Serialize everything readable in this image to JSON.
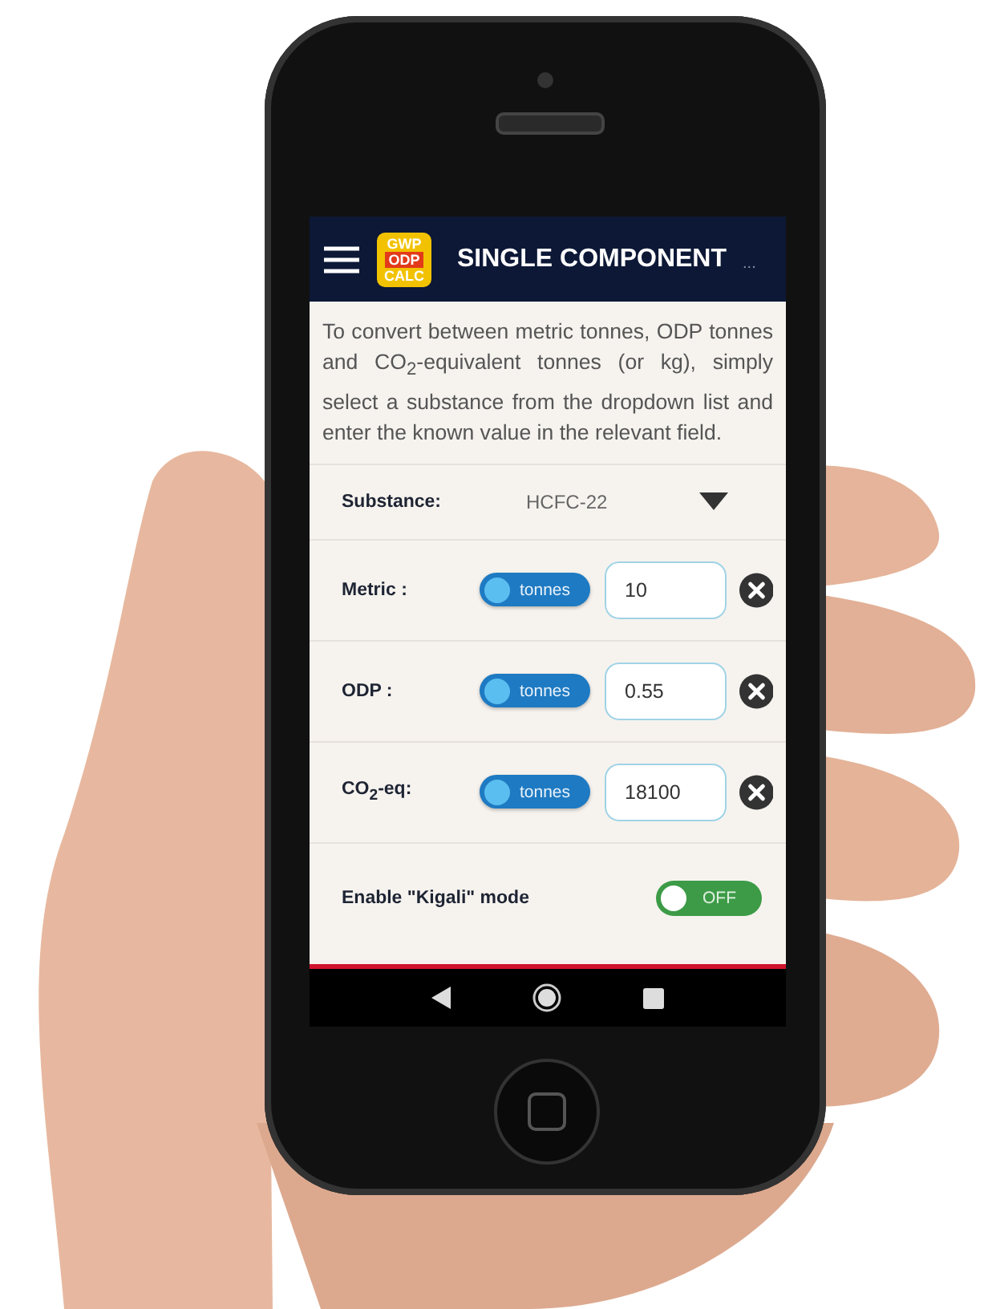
{
  "header": {
    "logo": [
      "GWP",
      "ODP",
      "CALC"
    ],
    "title": "SINGLE COMPONENT",
    "more": "..."
  },
  "intro": "To convert between metric tonnes, ODP tonnes and CO$_{2}$-equivalent tonnes (or kg), simply select a substance from the dropdown list and enter the known value in the relevant field.",
  "substance": {
    "label": "Substance:",
    "value": "HCFC-22"
  },
  "fields": [
    {
      "label": "Metric :",
      "unit": "tonnes",
      "value": "10"
    },
    {
      "label": "ODP :",
      "unit": "tonnes",
      "value": "0.55"
    },
    {
      "label": "CO$_{2}$-eq:",
      "unit": "tonnes",
      "value": "18100"
    }
  ],
  "kigali": {
    "label": "Enable \"Kigali\" mode",
    "on": false,
    "state_text": "OFF"
  }
}
